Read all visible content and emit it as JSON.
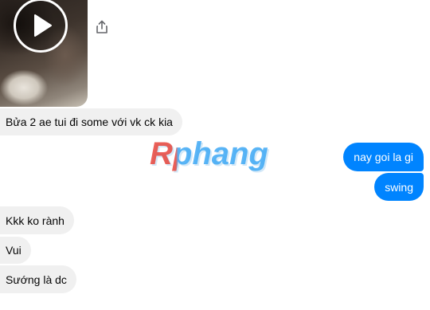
{
  "conversation": {
    "video_message": {
      "play_icon": "play-icon",
      "share_icon": "share-icon"
    },
    "messages": [
      {
        "side": "incoming",
        "text": "Bửa 2 ae tui đi some với vk ck kia"
      },
      {
        "side": "outgoing",
        "text": "nay goi la gi"
      },
      {
        "side": "outgoing",
        "text": "swing"
      },
      {
        "side": "incoming",
        "text": "Kkk ko rành"
      },
      {
        "side": "incoming",
        "text": "Vui"
      },
      {
        "side": "incoming",
        "text": "Sướng là dc"
      }
    ]
  },
  "watermark": {
    "text": "Rphang"
  },
  "colors": {
    "outgoing_bubble": "#0084ff",
    "incoming_bubble": "#f0f0f0",
    "watermark_red": "#e8453c",
    "watermark_blue": "#3fa9f5"
  }
}
